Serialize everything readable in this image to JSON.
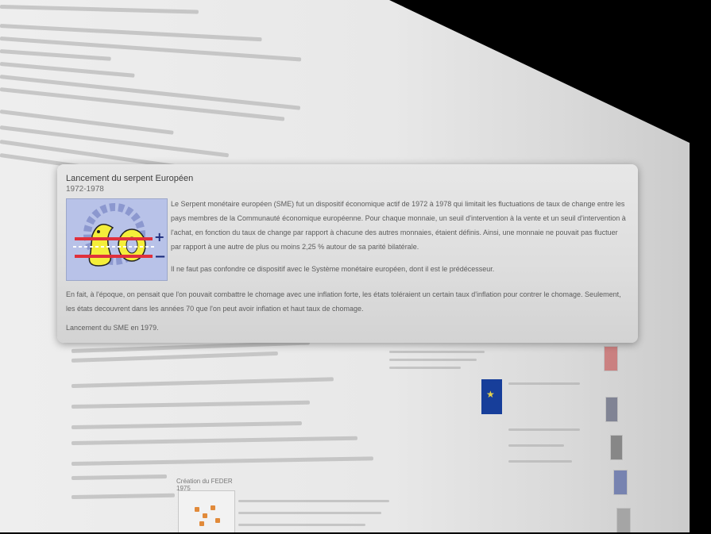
{
  "popup": {
    "title": "Lancement du serpent Européen",
    "years": "1972-1978",
    "logo_name": "serpent-monetaire-logo",
    "paragraph1": "Le Serpent monétaire européen (SME) fut un dispositif économique actif de 1972 à 1978 qui limitait les fluctuations de taux de change entre les pays membres de la Communauté économique européenne. Pour chaque monnaie, un seuil d'intervention à la vente et un seuil d'intervention à l'achat, en fonction du taux de change par rapport à chacune des autres monnaies, étaient définis. Ainsi, une monnaie ne pouvait pas fluctuer par rapport à une autre de plus ou moins 2,25 % autour de sa parité bilatérale.",
    "paragraph2": "Il ne faut pas confondre ce dispositif avec le Système monétaire européen, dont il est le prédécesseur.",
    "paragraph3": "En fait, à l'époque, on pensait que l'on pouvait combattre le chomage avec une inflation forte, les états toléraient un certain taux d'inflation pour contrer le chomage. Seulement, les états decouvrent dans les années 70 que l'on peut avoir inflation et haut taux de chomage.",
    "paragraph4": "Lancement du SME en 1979."
  },
  "background": {
    "caption_feder": "Création du FEDER",
    "caption_feder_year": "1975"
  },
  "colors": {
    "logo_background": "#b3bde6",
    "logo_serpent": "#f4ee3a",
    "logo_band": "#e0303c",
    "eu_flag": "#173e9a"
  }
}
